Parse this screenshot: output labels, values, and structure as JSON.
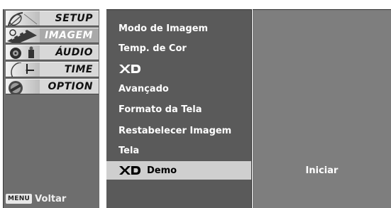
{
  "categories": [
    {
      "label": "SETUP",
      "icon": "satellite-dish-icon",
      "selected": false
    },
    {
      "label": "IMAGEM",
      "icon": "film-strip-icon",
      "selected": true
    },
    {
      "label": "ÁUDIO",
      "icon": "speaker-icon",
      "selected": false
    },
    {
      "label": "TIME",
      "icon": "clock-icon",
      "selected": false
    },
    {
      "label": "OPTION",
      "icon": "option-badge-icon",
      "selected": false
    }
  ],
  "footer": {
    "menu_key": "MENU",
    "back_label": "Voltar"
  },
  "menu": {
    "items": [
      {
        "label": "Modo de Imagem"
      },
      {
        "label": "Temp. de Cor"
      },
      {
        "label": "",
        "logo": "XD"
      },
      {
        "label": "Avançado"
      },
      {
        "label": "Formato da Tela"
      },
      {
        "label": "Restabelecer Imagem"
      },
      {
        "label": "Tela"
      },
      {
        "label": "Demo",
        "logo": "XD",
        "highlighted": true
      }
    ]
  },
  "submenu": {
    "option_label": "Iniciar"
  },
  "colors": {
    "highlight": "#cfcfcf",
    "menu_bg": "#5a5a5a",
    "sub_bg": "#7e7e7e",
    "category_bg": "#6e6e6e"
  }
}
